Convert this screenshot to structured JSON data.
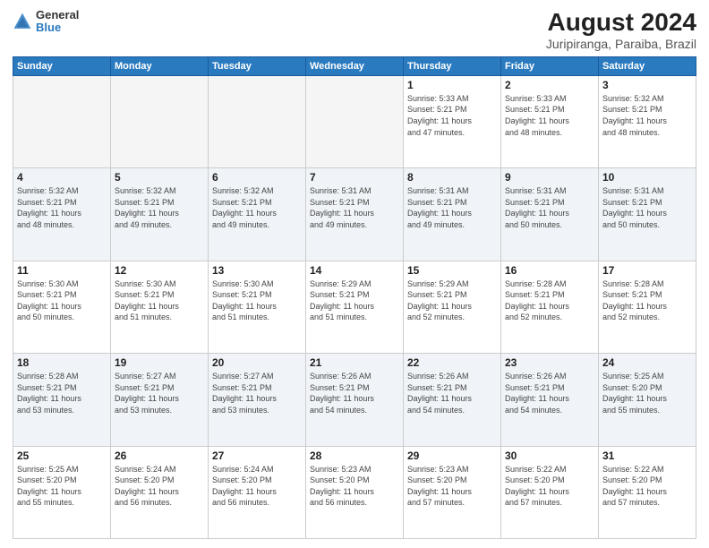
{
  "header": {
    "logo_line1": "General",
    "logo_line2": "Blue",
    "title": "August 2024",
    "subtitle": "Juripiranga, Paraiba, Brazil"
  },
  "weekdays": [
    "Sunday",
    "Monday",
    "Tuesday",
    "Wednesday",
    "Thursday",
    "Friday",
    "Saturday"
  ],
  "weeks": [
    [
      {
        "day": "",
        "info": "",
        "empty": true
      },
      {
        "day": "",
        "info": "",
        "empty": true
      },
      {
        "day": "",
        "info": "",
        "empty": true
      },
      {
        "day": "",
        "info": "",
        "empty": true
      },
      {
        "day": "1",
        "info": "Sunrise: 5:33 AM\nSunset: 5:21 PM\nDaylight: 11 hours\nand 47 minutes."
      },
      {
        "day": "2",
        "info": "Sunrise: 5:33 AM\nSunset: 5:21 PM\nDaylight: 11 hours\nand 48 minutes."
      },
      {
        "day": "3",
        "info": "Sunrise: 5:32 AM\nSunset: 5:21 PM\nDaylight: 11 hours\nand 48 minutes."
      }
    ],
    [
      {
        "day": "4",
        "info": "Sunrise: 5:32 AM\nSunset: 5:21 PM\nDaylight: 11 hours\nand 48 minutes."
      },
      {
        "day": "5",
        "info": "Sunrise: 5:32 AM\nSunset: 5:21 PM\nDaylight: 11 hours\nand 49 minutes."
      },
      {
        "day": "6",
        "info": "Sunrise: 5:32 AM\nSunset: 5:21 PM\nDaylight: 11 hours\nand 49 minutes."
      },
      {
        "day": "7",
        "info": "Sunrise: 5:31 AM\nSunset: 5:21 PM\nDaylight: 11 hours\nand 49 minutes."
      },
      {
        "day": "8",
        "info": "Sunrise: 5:31 AM\nSunset: 5:21 PM\nDaylight: 11 hours\nand 49 minutes."
      },
      {
        "day": "9",
        "info": "Sunrise: 5:31 AM\nSunset: 5:21 PM\nDaylight: 11 hours\nand 50 minutes."
      },
      {
        "day": "10",
        "info": "Sunrise: 5:31 AM\nSunset: 5:21 PM\nDaylight: 11 hours\nand 50 minutes."
      }
    ],
    [
      {
        "day": "11",
        "info": "Sunrise: 5:30 AM\nSunset: 5:21 PM\nDaylight: 11 hours\nand 50 minutes."
      },
      {
        "day": "12",
        "info": "Sunrise: 5:30 AM\nSunset: 5:21 PM\nDaylight: 11 hours\nand 51 minutes."
      },
      {
        "day": "13",
        "info": "Sunrise: 5:30 AM\nSunset: 5:21 PM\nDaylight: 11 hours\nand 51 minutes."
      },
      {
        "day": "14",
        "info": "Sunrise: 5:29 AM\nSunset: 5:21 PM\nDaylight: 11 hours\nand 51 minutes."
      },
      {
        "day": "15",
        "info": "Sunrise: 5:29 AM\nSunset: 5:21 PM\nDaylight: 11 hours\nand 52 minutes."
      },
      {
        "day": "16",
        "info": "Sunrise: 5:28 AM\nSunset: 5:21 PM\nDaylight: 11 hours\nand 52 minutes."
      },
      {
        "day": "17",
        "info": "Sunrise: 5:28 AM\nSunset: 5:21 PM\nDaylight: 11 hours\nand 52 minutes."
      }
    ],
    [
      {
        "day": "18",
        "info": "Sunrise: 5:28 AM\nSunset: 5:21 PM\nDaylight: 11 hours\nand 53 minutes."
      },
      {
        "day": "19",
        "info": "Sunrise: 5:27 AM\nSunset: 5:21 PM\nDaylight: 11 hours\nand 53 minutes."
      },
      {
        "day": "20",
        "info": "Sunrise: 5:27 AM\nSunset: 5:21 PM\nDaylight: 11 hours\nand 53 minutes."
      },
      {
        "day": "21",
        "info": "Sunrise: 5:26 AM\nSunset: 5:21 PM\nDaylight: 11 hours\nand 54 minutes."
      },
      {
        "day": "22",
        "info": "Sunrise: 5:26 AM\nSunset: 5:21 PM\nDaylight: 11 hours\nand 54 minutes."
      },
      {
        "day": "23",
        "info": "Sunrise: 5:26 AM\nSunset: 5:21 PM\nDaylight: 11 hours\nand 54 minutes."
      },
      {
        "day": "24",
        "info": "Sunrise: 5:25 AM\nSunset: 5:20 PM\nDaylight: 11 hours\nand 55 minutes."
      }
    ],
    [
      {
        "day": "25",
        "info": "Sunrise: 5:25 AM\nSunset: 5:20 PM\nDaylight: 11 hours\nand 55 minutes."
      },
      {
        "day": "26",
        "info": "Sunrise: 5:24 AM\nSunset: 5:20 PM\nDaylight: 11 hours\nand 56 minutes."
      },
      {
        "day": "27",
        "info": "Sunrise: 5:24 AM\nSunset: 5:20 PM\nDaylight: 11 hours\nand 56 minutes."
      },
      {
        "day": "28",
        "info": "Sunrise: 5:23 AM\nSunset: 5:20 PM\nDaylight: 11 hours\nand 56 minutes."
      },
      {
        "day": "29",
        "info": "Sunrise: 5:23 AM\nSunset: 5:20 PM\nDaylight: 11 hours\nand 57 minutes."
      },
      {
        "day": "30",
        "info": "Sunrise: 5:22 AM\nSunset: 5:20 PM\nDaylight: 11 hours\nand 57 minutes."
      },
      {
        "day": "31",
        "info": "Sunrise: 5:22 AM\nSunset: 5:20 PM\nDaylight: 11 hours\nand 57 minutes."
      }
    ]
  ]
}
